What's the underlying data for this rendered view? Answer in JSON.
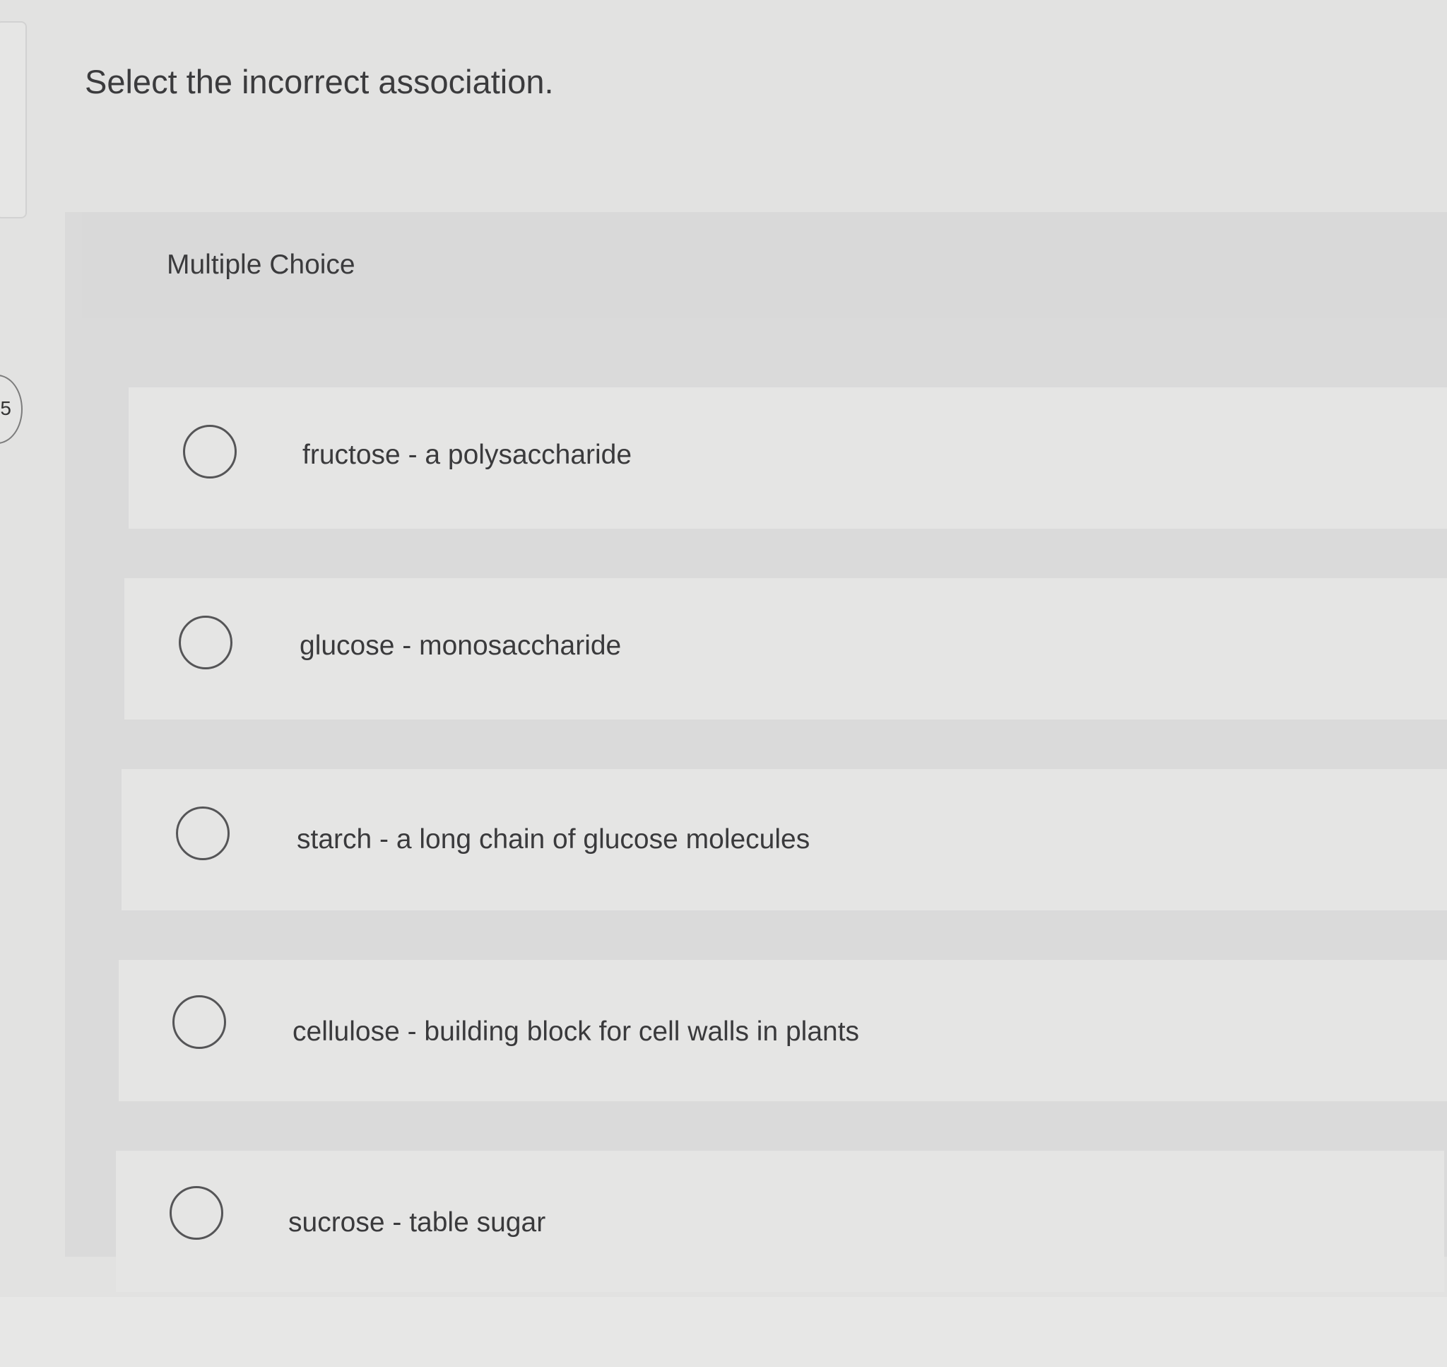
{
  "question": {
    "number": "5",
    "prompt": "Select the incorrect association."
  },
  "multiple_choice": {
    "heading": "Multiple Choice",
    "options": [
      {
        "label": "fructose - a polysaccharide",
        "selected": false
      },
      {
        "label": "glucose - monosaccharide",
        "selected": false
      },
      {
        "label": "starch - a long chain of glucose molecules",
        "selected": false
      },
      {
        "label": "cellulose - building block for cell walls in plants",
        "selected": false
      },
      {
        "label": "sucrose - table sugar",
        "selected": false
      }
    ]
  },
  "colors": {
    "page_background": "#e2e2e1",
    "panel_background": "#dadada",
    "option_background": "#e5e5e4",
    "text": "#3a3a3c",
    "radio_border": "#555557"
  },
  "icons": {
    "radio": "empty-circle"
  }
}
